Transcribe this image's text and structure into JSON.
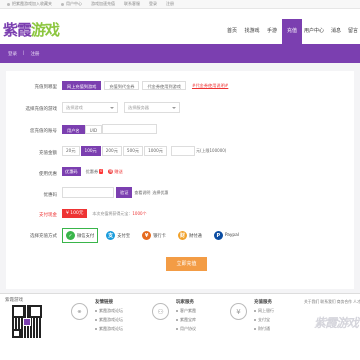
{
  "topbar": {
    "items": [
      "把紫霞游戏加入收藏夹",
      "用户中心",
      "游戏加速充值",
      "联系客服",
      "登录",
      "注册"
    ]
  },
  "header": {
    "logo_part1": "紫霞",
    "logo_part2": "游戏",
    "nav": [
      "首页",
      "找游戏",
      "手游",
      "充值",
      "用户中心",
      "消息",
      "留言"
    ]
  },
  "strip": {
    "login": "登录",
    "register": "注册"
  },
  "form": {
    "target_label": "充值到哪里",
    "target_tabs": [
      "网上充值到游戏",
      "充值到代金券",
      "代金券使用到游戏"
    ],
    "target_hint": "#代金券使用说明#",
    "game_label": "选择充值的游戏",
    "game_select": "选择游戏",
    "server_select": "选择服务器",
    "account_label": "您充值的账号",
    "account_tabs": [
      "用户名",
      "UID"
    ],
    "amount_label": "充值金额",
    "amounts": [
      "20元",
      "100元",
      "200元",
      "500元",
      "1000元"
    ],
    "amount_custom_hint": "元(上限100000)",
    "discount_label": "使用优惠",
    "discount_tabs": [
      "优惠码",
      "优惠券"
    ],
    "discount_badge": "0",
    "discount_tag_icon": "赠",
    "discount_tag": "赠送",
    "coupon_label": "优惠码",
    "verify_button": "验证",
    "coupon_links": [
      "查看说明",
      "选择优惠"
    ],
    "pay_label": "支付现金",
    "pay_amount": "¥ 100元",
    "pay_note_prefix": "本次充值将获得元宝：",
    "pay_note_value": "1000个",
    "method_label": "选择充值方式",
    "methods": [
      {
        "name": "微信支付",
        "icon": "wechat-icon",
        "color": "#39b54a",
        "glyph": "✓"
      },
      {
        "name": "支付宝",
        "icon": "alipay-icon",
        "color": "#1a9cdc",
        "glyph": "支"
      },
      {
        "name": "银行卡",
        "icon": "bank-icon",
        "color": "#e66a1e",
        "glyph": "¥"
      },
      {
        "name": "财付通",
        "icon": "tenpay-icon",
        "color": "#f1a22c",
        "glyph": "财"
      },
      {
        "name": "Paypal",
        "icon": "paypal-icon",
        "color": "#0c4da2",
        "glyph": "P"
      }
    ],
    "submit": "立即充值"
  },
  "footer": {
    "qr_title": "紫霞游戏",
    "links_title": "友情链接",
    "links": [
      "紫霞游戏论坛",
      "紫霞游戏论坛",
      "紫霞游戏论坛"
    ],
    "player_title": "玩家服务",
    "player": [
      "客户紫霞",
      "紫霞宝库",
      "用户协议"
    ],
    "recharge_title": "充值服务",
    "recharge": [
      "网上银行",
      "支付宝",
      "财付通"
    ],
    "about": "关于我们 联系我们 商务合作 人才招聘",
    "watermark": "紫霞游戏"
  }
}
